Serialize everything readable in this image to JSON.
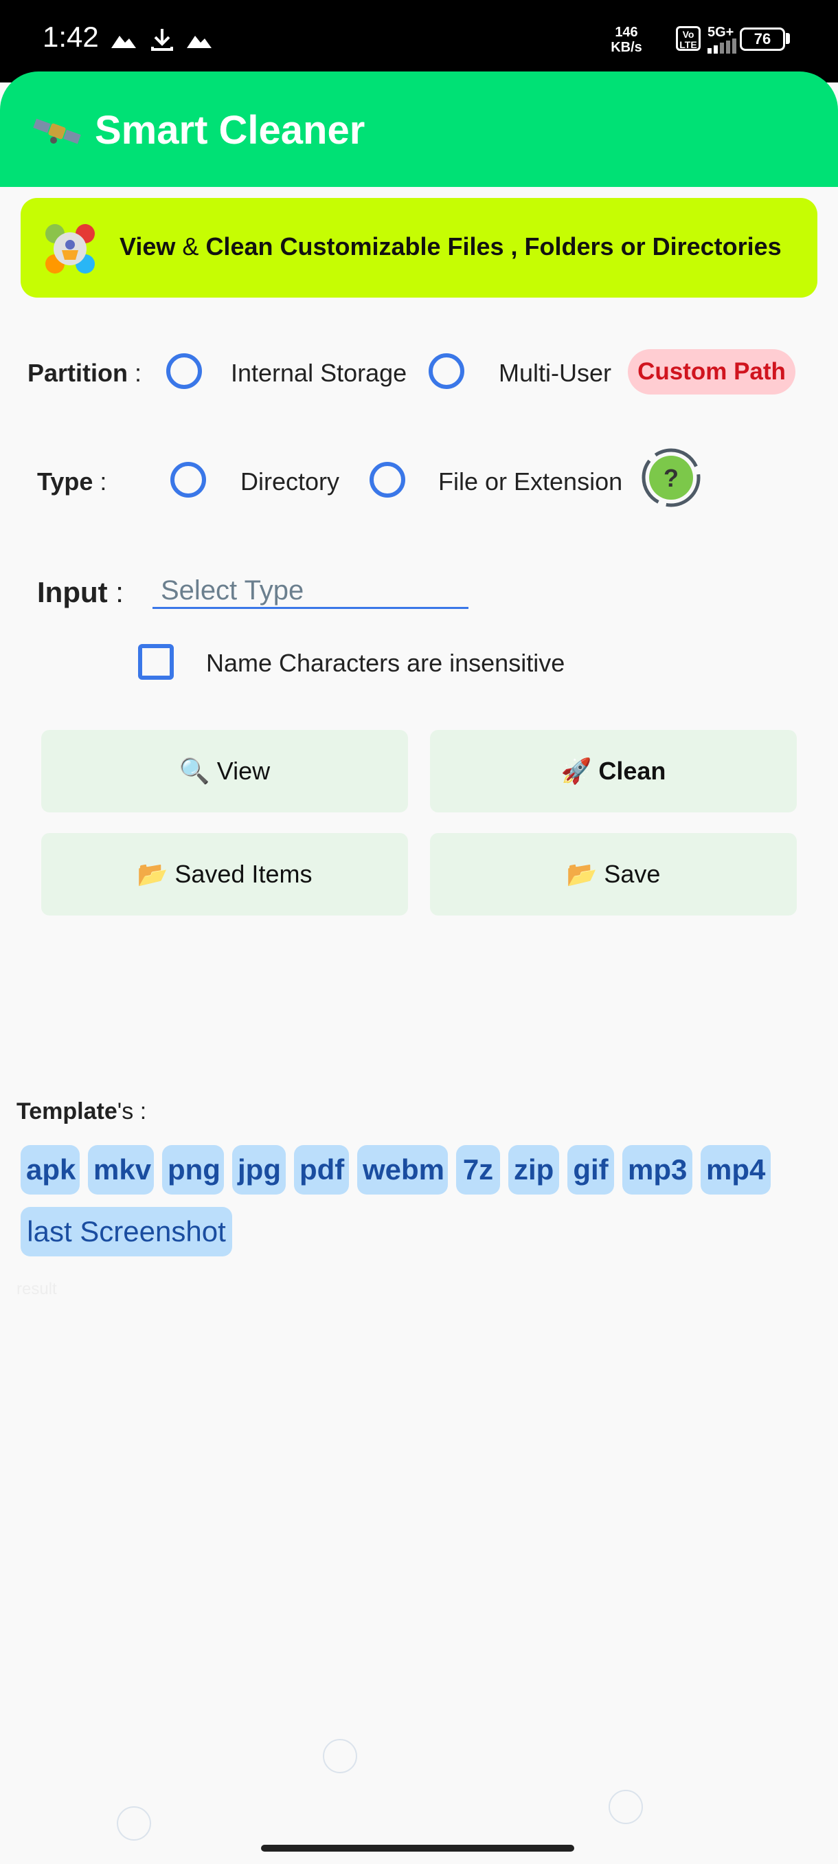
{
  "status_bar": {
    "time": "1:42",
    "net_speed_value": "146",
    "net_speed_unit": "KB/s",
    "volte": "Vo LTE",
    "network": "5G+",
    "battery": "76"
  },
  "app_bar": {
    "title": "Smart Cleaner"
  },
  "banner": {
    "text_view": "View",
    "text_amp": "&",
    "text_rest": "Clean Customizable Files , Folders or Directories"
  },
  "partition": {
    "label": "Partition",
    "colon": ":",
    "options": [
      "Internal Storage",
      "Multi-User"
    ],
    "custom_path": "Custom Path"
  },
  "type": {
    "label": "Type",
    "colon": ":",
    "options": [
      "Directory",
      "File or Extension"
    ],
    "help": "?"
  },
  "input": {
    "label": "Input",
    "colon": ":",
    "placeholder": "Select Type",
    "checkbox_label": "Name Characters are insensitive"
  },
  "buttons": {
    "view": "🔍 View",
    "clean": "🚀 Clean",
    "saved_items": "📂 Saved Items",
    "save": "📂 Save"
  },
  "templates": {
    "label_bold": "Template",
    "label_rest": "'s :",
    "chips": [
      "apk",
      "mkv",
      "png",
      "jpg",
      "pdf",
      "webm",
      "7z",
      "zip",
      "gif",
      "mp3",
      "mp4",
      "last Screenshot"
    ]
  },
  "result": "result",
  "colors": {
    "appbar": "#00e175",
    "banner": "#c6fd03",
    "accent": "#3a77e8",
    "chip_bg": "#bbdefb",
    "chip_text": "#1a4da0",
    "custom_path_bg": "#ffcdd2",
    "custom_path_text": "#d0141e",
    "button_bg": "#e8f5e9"
  }
}
